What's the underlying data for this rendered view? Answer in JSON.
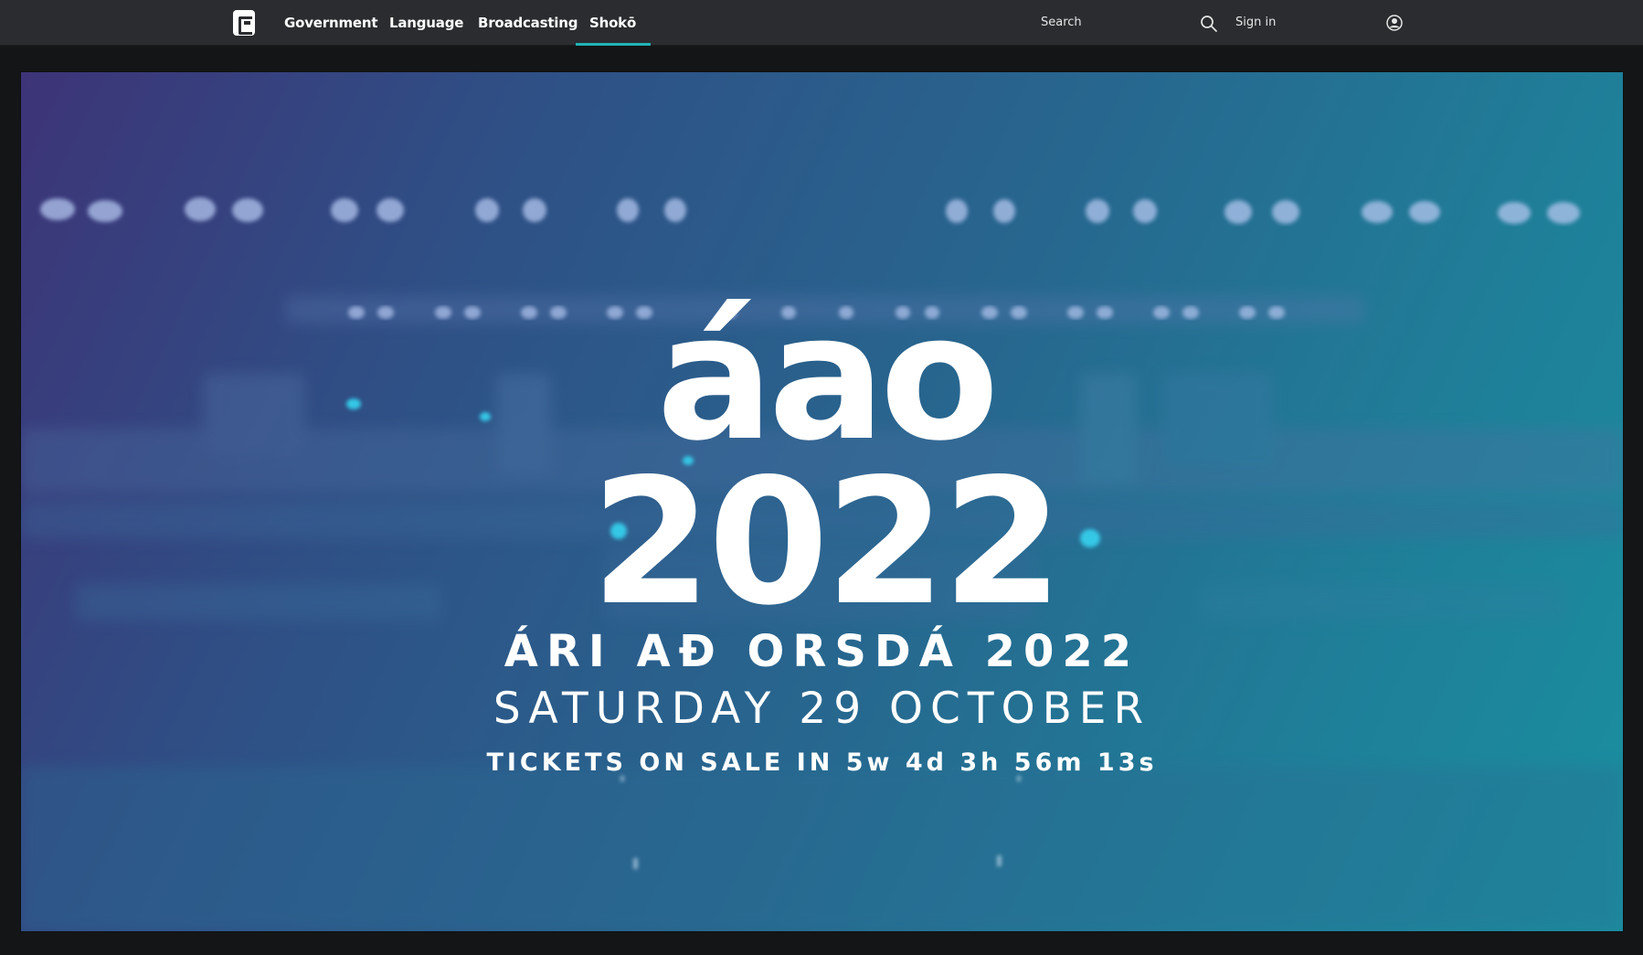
{
  "nav": {
    "logo_alt": "",
    "items": [
      {
        "label": "Government",
        "active": false
      },
      {
        "label": "Language",
        "active": false
      },
      {
        "label": "Broadcasting",
        "active": false
      },
      {
        "label": "Shokō",
        "active": true
      }
    ],
    "search_label": "Search",
    "sign_in_label": "Sign in",
    "accent_color": "#1fb3b6"
  },
  "hero": {
    "logo_word": "áao",
    "logo_year": "2022",
    "headline": "ÁRI AÐ ORSDÁ 2022",
    "date": "SATURDAY 29 OCTOBER",
    "countdown": "TICKETS ON SALE IN 5w 4d 3h 56m 13s"
  }
}
